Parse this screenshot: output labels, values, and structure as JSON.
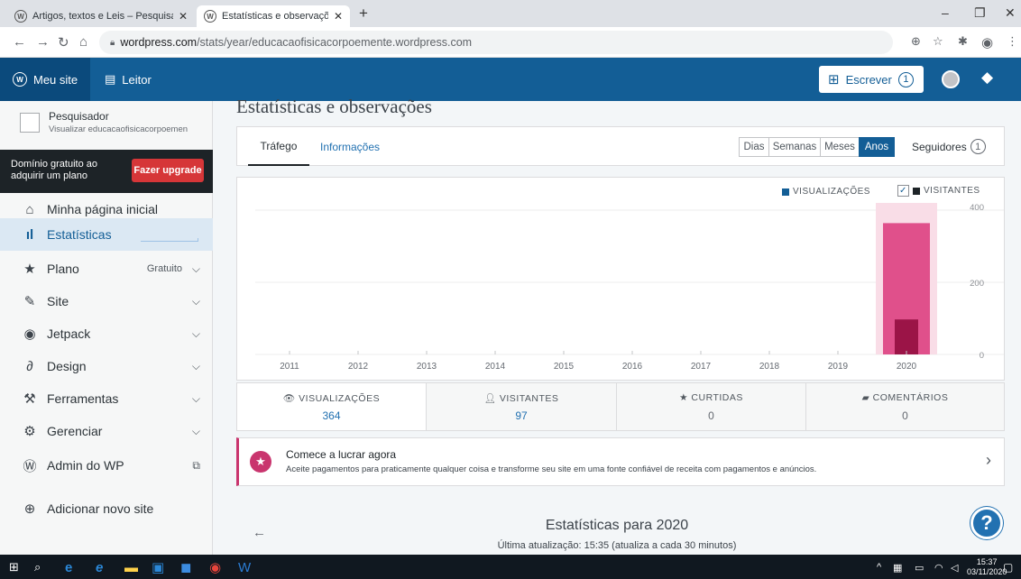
{
  "browser": {
    "tabs": [
      {
        "title": "Artigos, textos e Leis – Pesquisad",
        "active": false
      },
      {
        "title": "Estatísticas e observações ‹ Pesq",
        "active": true
      }
    ],
    "url_domain": "wordpress.com",
    "url_path": "/stats/year/educacaofisicacorpoemente.wordpress.com"
  },
  "masterbar": {
    "my_site": "Meu site",
    "reader": "Leitor",
    "write": "Escrever",
    "write_count": "1"
  },
  "sidebar": {
    "site_name": "Pesquisador",
    "site_url": "Visualizar educacaofisicacorpoemen",
    "upgrade_text": "Domínio gratuito ao adquirir um plano",
    "upgrade_button": "Fazer upgrade",
    "items": [
      {
        "label": "Minha página inicial",
        "icon": "home-icon",
        "chevron": false
      },
      {
        "label": "Estatísticas",
        "icon": "stats-icon",
        "chevron": false,
        "active": true
      },
      {
        "label": "Plano",
        "icon": "star-icon",
        "extra": "Gratuito",
        "chevron": true
      },
      {
        "label": "Site",
        "icon": "pencil-icon",
        "chevron": true
      },
      {
        "label": "Jetpack",
        "icon": "jetpack-icon",
        "chevron": true
      },
      {
        "label": "Design",
        "icon": "design-icon",
        "chevron": true
      },
      {
        "label": "Ferramentas",
        "icon": "tools-icon",
        "chevron": true
      },
      {
        "label": "Gerenciar",
        "icon": "gear-icon",
        "chevron": true
      },
      {
        "label": "Admin do WP",
        "icon": "wordpress-icon",
        "chevron": false
      }
    ],
    "add_site": "Adicionar novo site"
  },
  "main": {
    "title": "Estatísticas e observações",
    "tabs": [
      "Tráfego",
      "Informações"
    ],
    "periods": [
      "Dias",
      "Semanas",
      "Meses",
      "Anos"
    ],
    "active_period": "Anos",
    "followers_label": "Seguidores",
    "followers_count": "1"
  },
  "chart_data": {
    "type": "bar",
    "categories": [
      "2011",
      "2012",
      "2013",
      "2014",
      "2015",
      "2016",
      "2017",
      "2018",
      "2019",
      "2020"
    ],
    "series": [
      {
        "name": "VISUALIZAÇÕES",
        "values": [
          0,
          0,
          0,
          0,
          0,
          0,
          0,
          0,
          0,
          364
        ],
        "color": "#e0508b"
      },
      {
        "name": "VISITANTES",
        "values": [
          0,
          0,
          0,
          0,
          0,
          0,
          0,
          0,
          0,
          97
        ],
        "color": "#9b1447"
      }
    ],
    "ylim": [
      0,
      400
    ],
    "yticks": [
      "0",
      "200",
      "400"
    ],
    "legend_position": "top-right",
    "selected_category": "2020"
  },
  "stats": [
    {
      "label": "VISUALIZAÇÕES",
      "value": "364",
      "icon": "eye-icon"
    },
    {
      "label": "VISITANTES",
      "value": "97",
      "icon": "person-icon"
    },
    {
      "label": "CURTIDAS",
      "value": "0",
      "icon": "star-icon"
    },
    {
      "label": "COMENTÁRIOS",
      "value": "0",
      "icon": "comment-icon"
    }
  ],
  "promo": {
    "title": "Comece a lucrar agora",
    "description": "Aceite pagamentos para praticamente qualquer coisa e transforme seu site em uma fonte confiável de receita com pagamentos e anúncios."
  },
  "period_footer": {
    "title": "Estatísticas para 2020",
    "subtitle": "Última atualização: 15:35 (atualiza a cada 30 minutos)"
  },
  "taskbar": {
    "time": "15:37",
    "date": "03/11/2020"
  },
  "colors": {
    "masterbar": "#135e96",
    "accent": "#c9356e",
    "views_bar": "#e0508b",
    "visitors_bar": "#9b1447"
  }
}
